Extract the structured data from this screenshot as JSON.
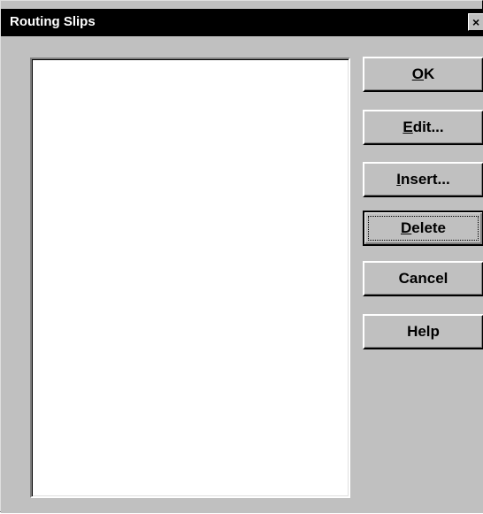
{
  "window": {
    "title": "Routing Slips",
    "close_glyph": "×",
    "close_icon": "close-icon"
  },
  "listbox": {
    "items": []
  },
  "buttons": {
    "ok": {
      "mnemonic": "O",
      "rest": "K"
    },
    "edit": {
      "mnemonic": "E",
      "rest": "dit..."
    },
    "insert": {
      "mnemonic": "I",
      "rest": "nsert..."
    },
    "delete": {
      "mnemonic": "D",
      "rest": "elete"
    },
    "cancel": {
      "label": "Cancel"
    },
    "help": {
      "label": "Help"
    }
  },
  "colors": {
    "face": "#c0c0c0",
    "titlebar": "#000000",
    "title_text": "#ffffff",
    "list_bg": "#ffffff"
  }
}
